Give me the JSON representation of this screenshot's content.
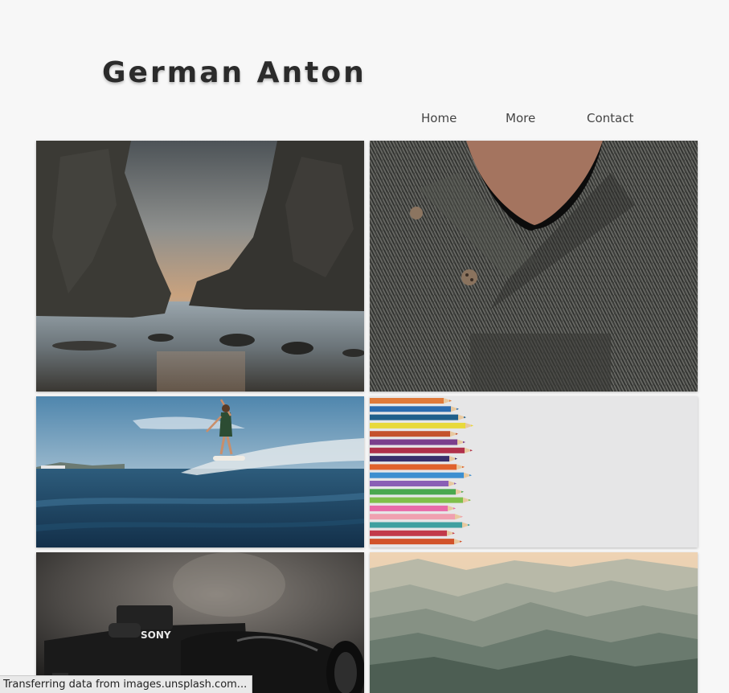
{
  "header": {
    "title": "German Anton"
  },
  "nav": {
    "home": "Home",
    "more": "More",
    "contact": "Contact"
  },
  "gallery": {
    "tiles": [
      {
        "subject": "sea-rocks-sunset"
      },
      {
        "subject": "knit-sweater"
      },
      {
        "subject": "surfer-wave"
      },
      {
        "subject": "colored-pencils"
      },
      {
        "subject": "camera-lens"
      },
      {
        "subject": "misty-mountains"
      }
    ],
    "camera_brand": "SONY"
  },
  "status_bar": {
    "text": "Transferring data from images.unsplash.com..."
  },
  "colors": {
    "background": "#f7f7f7",
    "title": "#2b2b2b",
    "nav_text": "#444444"
  }
}
